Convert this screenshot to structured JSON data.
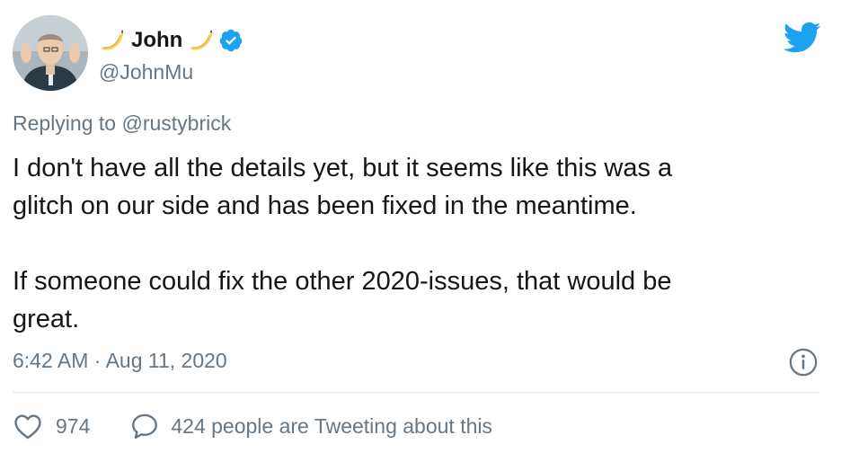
{
  "tweet": {
    "author_name": "John",
    "author_handle": "@JohnMu",
    "reply_prefix": "Replying to",
    "reply_to": "@rustybrick",
    "text": "I don't have all the details yet, but it seems like this was a\nglitch on our side and has been fixed in the meantime.\n\nIf someone could fix the other 2020-issues, that would be\ngreat.",
    "time": "6:42 AM",
    "separator": "·",
    "date": "Aug 11, 2020",
    "likes": "974",
    "tweeting_about": "424 people are Tweeting about this"
  },
  "icons": {
    "brand": "twitter-bird-icon",
    "verified": "verified-badge-icon",
    "name_decoration": "banana-emoji-icon",
    "info": "info-icon",
    "like": "heart-icon",
    "comment": "speech-bubble-icon"
  },
  "colors": {
    "twitter_blue": "#1da1f2",
    "secondary_text": "#657786",
    "primary_text": "#14171a"
  }
}
